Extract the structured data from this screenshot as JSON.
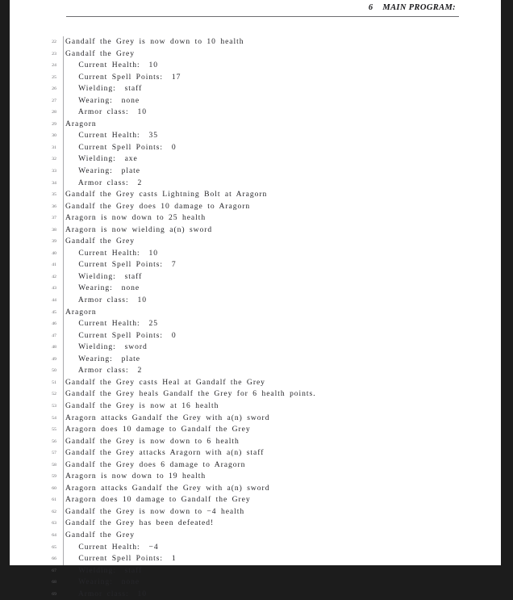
{
  "document": {
    "header": {
      "section_number": "6",
      "section_title": "MAIN PROGRAM:",
      "full_text": "6    MAIN PROGRAM:"
    }
  },
  "listing": {
    "first_line_number": 22,
    "lines": [
      {
        "n": "22",
        "text": "Gandalf the Grey is now down to 10 health"
      },
      {
        "n": "23",
        "text": "Gandalf the Grey"
      },
      {
        "n": "24",
        "text": "   Current Health:  10"
      },
      {
        "n": "25",
        "text": "   Current Spell Points:  17"
      },
      {
        "n": "26",
        "text": "   Wielding:  staff"
      },
      {
        "n": "27",
        "text": "   Wearing:  none"
      },
      {
        "n": "28",
        "text": "   Armor class:  10"
      },
      {
        "n": "29",
        "text": "Aragorn"
      },
      {
        "n": "30",
        "text": "   Current Health:  35"
      },
      {
        "n": "31",
        "text": "   Current Spell Points:  0"
      },
      {
        "n": "32",
        "text": "   Wielding:  axe"
      },
      {
        "n": "33",
        "text": "   Wearing:  plate"
      },
      {
        "n": "34",
        "text": "   Armor class:  2"
      },
      {
        "n": "35",
        "text": "Gandalf the Grey casts Lightning Bolt at Aragorn"
      },
      {
        "n": "36",
        "text": "Gandalf the Grey does 10 damage to Aragorn"
      },
      {
        "n": "37",
        "text": "Aragorn is now down to 25 health"
      },
      {
        "n": "38",
        "text": "Aragorn is now wielding a(n) sword"
      },
      {
        "n": "39",
        "text": "Gandalf the Grey"
      },
      {
        "n": "40",
        "text": "   Current Health:  10"
      },
      {
        "n": "41",
        "text": "   Current Spell Points:  7"
      },
      {
        "n": "42",
        "text": "   Wielding:  staff"
      },
      {
        "n": "43",
        "text": "   Wearing:  none"
      },
      {
        "n": "44",
        "text": "   Armor class:  10"
      },
      {
        "n": "45",
        "text": "Aragorn"
      },
      {
        "n": "46",
        "text": "   Current Health:  25"
      },
      {
        "n": "47",
        "text": "   Current Spell Points:  0"
      },
      {
        "n": "48",
        "text": "   Wielding:  sword"
      },
      {
        "n": "49",
        "text": "   Wearing:  plate"
      },
      {
        "n": "50",
        "text": "   Armor class:  2"
      },
      {
        "n": "51",
        "text": "Gandalf the Grey casts Heal at Gandalf the Grey"
      },
      {
        "n": "52",
        "text": "Gandalf the Grey heals Gandalf the Grey for 6 health points."
      },
      {
        "n": "53",
        "text": "Gandalf the Grey is now at 16 health"
      },
      {
        "n": "54",
        "text": "Aragorn attacks Gandalf the Grey with a(n) sword"
      },
      {
        "n": "55",
        "text": "Aragorn does 10 damage to Gandalf the Grey"
      },
      {
        "n": "56",
        "text": "Gandalf the Grey is now down to 6 health"
      },
      {
        "n": "57",
        "text": "Gandalf the Grey attacks Aragorn with a(n) staff"
      },
      {
        "n": "58",
        "text": "Gandalf the Grey does 6 damage to Aragorn"
      },
      {
        "n": "59",
        "text": "Aragorn is now down to 19 health"
      },
      {
        "n": "60",
        "text": "Aragorn attacks Gandalf the Grey with a(n) sword"
      },
      {
        "n": "61",
        "text": "Aragorn does 10 damage to Gandalf the Grey"
      },
      {
        "n": "62",
        "text": "Gandalf the Grey is now down to −4 health"
      },
      {
        "n": "63",
        "text": "Gandalf the Grey has been defeated!"
      },
      {
        "n": "64",
        "text": "Gandalf the Grey"
      },
      {
        "n": "65",
        "text": "   Current Health:  −4"
      },
      {
        "n": "66",
        "text": "   Current Spell Points:  1"
      },
      {
        "n": "67",
        "text": "   Wielding:  staff"
      },
      {
        "n": "68",
        "text": "   Wearing:  none"
      },
      {
        "n": "69",
        "text": "   Armor class:  10"
      }
    ]
  },
  "colors": {
    "viewer_background": "#1c1c1c",
    "page_background": "#ffffff",
    "body_text": "#26262a",
    "line_number": "#5d5d61",
    "rule": "#a9a9ad",
    "header_rule": "#6e6e72"
  }
}
